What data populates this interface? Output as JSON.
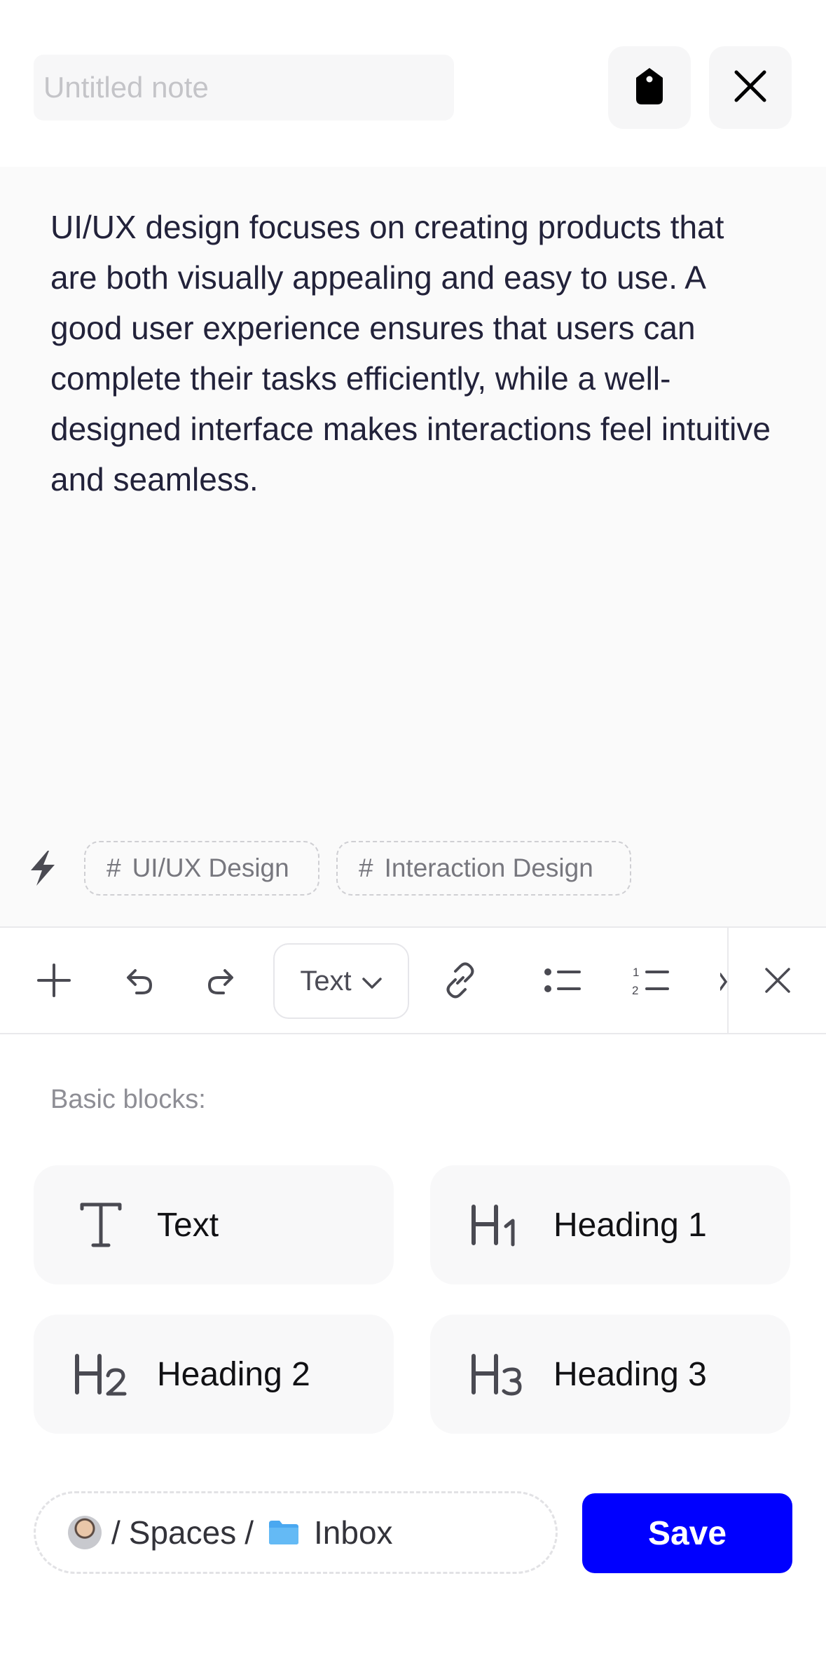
{
  "header": {
    "title_placeholder": "Untitled note",
    "tag_icon": "tag-icon",
    "close_icon": "close-icon"
  },
  "note": {
    "body": "UI/UX design focuses on creating products that are both visually appealing and easy to use. A good user experience ensures that users can complete their tasks efficiently, while a well-designed interface makes interactions feel intuitive and seamless."
  },
  "tags": {
    "icon": "bolt-icon",
    "items": [
      {
        "hash": "#",
        "label": "UI/UX Design"
      },
      {
        "hash": "#",
        "label": "Interaction Design"
      }
    ]
  },
  "toolbar": {
    "add_icon": "plus-icon",
    "undo_icon": "undo-icon",
    "redo_icon": "redo-icon",
    "block_type": "Text",
    "link_icon": "link-icon",
    "bullet_list_icon": "bullet-list-icon",
    "numbered_list_icon": "numbered-list-icon",
    "close_icon": "close-icon"
  },
  "blocks": {
    "label": "Basic blocks:",
    "items": [
      {
        "icon": "text-icon",
        "label": "Text"
      },
      {
        "icon": "heading-1-icon",
        "label": "Heading 1"
      },
      {
        "icon": "heading-2-icon",
        "label": "Heading 2"
      },
      {
        "icon": "heading-3-icon",
        "label": "Heading 3"
      }
    ]
  },
  "footer": {
    "path_sep1": "/",
    "path_spaces": "Spaces",
    "path_sep2": "/",
    "path_folder": "Inbox",
    "save_label": "Save"
  },
  "colors": {
    "accent": "#0000ff",
    "text_primary": "#22223a",
    "text_muted": "#8e8e95",
    "folder": "#4aa8f0"
  }
}
